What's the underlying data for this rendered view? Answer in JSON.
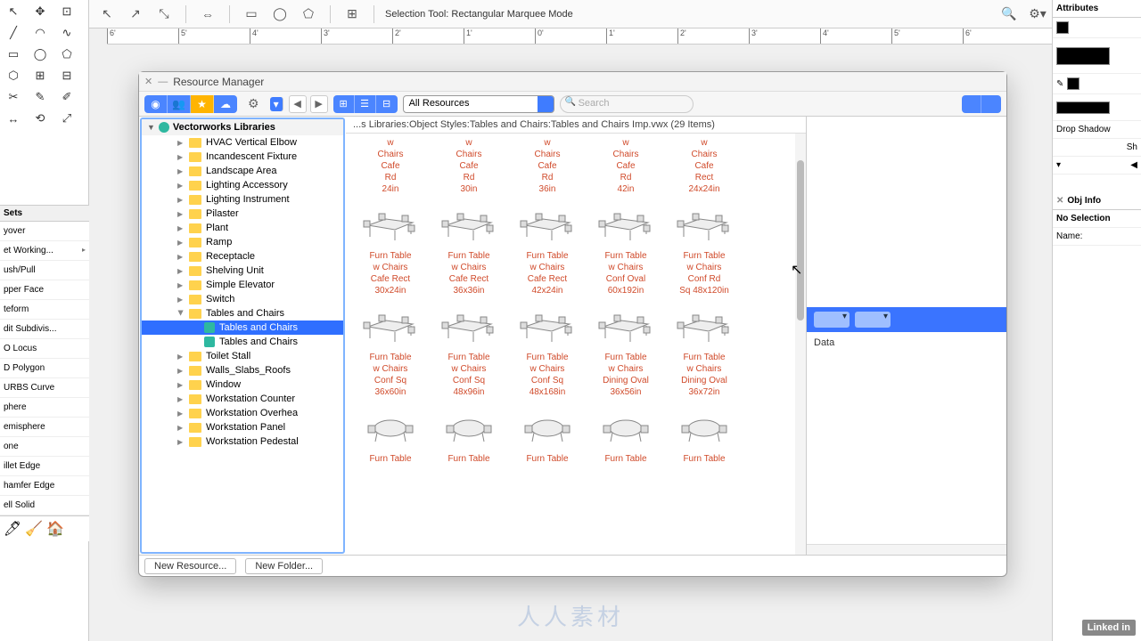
{
  "top_toolbar": {
    "label": "Selection Tool: Rectangular Marquee Mode"
  },
  "ruler_ticks": [
    "6'",
    "5'",
    "4'",
    "3'",
    "2'",
    "1'",
    "0'",
    "1'",
    "2'",
    "3'",
    "4'",
    "5'",
    "6'"
  ],
  "left_sets": {
    "head": "Sets",
    "rows": [
      "yover",
      "et Working...",
      "ush/Pull",
      "pper Face",
      "teform",
      "dit Subdivis...",
      "O Locus",
      "D Polygon",
      "URBS Curve",
      "phere",
      "emisphere",
      "one",
      "illet Edge",
      "hamfer Edge",
      "ell Solid"
    ]
  },
  "right_panel": {
    "attributes": "Attributes",
    "drop_shadow": "Drop Shadow",
    "obj_info": "Obj Info",
    "no_selection": "No Selection",
    "name_label": "Name:",
    "sh": "Sh"
  },
  "rm": {
    "title": "Resource Manager",
    "filter": "All Resources",
    "search_placeholder": "Search",
    "tree_head": "Vectorworks Libraries",
    "path": "...s Libraries:Object Styles:Tables and Chairs:Tables and Chairs Imp.vwx  (29 Items)",
    "preview_data": "Data",
    "new_resource": "New Resource...",
    "new_folder": "New Folder...",
    "folders": [
      "HVAC Vertical Elbow",
      "Incandescent Fixture",
      "Landscape Area",
      "Lighting Accessory",
      "Lighting Instrument",
      "Pilaster",
      "Plant",
      "Ramp",
      "Receptacle",
      "Shelving Unit",
      "Simple Elevator",
      "Switch"
    ],
    "folder_open": "Tables and Chairs",
    "files": [
      "Tables and Chairs",
      "Tables and Chairs"
    ],
    "folders_after": [
      "Toilet Stall",
      "Walls_Slabs_Roofs",
      "Window",
      "Workstation Counter",
      "Workstation Overhea",
      "Workstation Panel",
      "Workstation Pedestal"
    ],
    "partial_row": [
      "w Chairs Cafe Rd 24in",
      "w Chairs Cafe Rd 30in",
      "w Chairs Cafe Rd 36in",
      "w Chairs Cafe Rd 42in",
      "w Chairs Cafe Rect 24x24in"
    ],
    "rows": [
      [
        "Furn Table w Chairs Cafe Rect 30x24in",
        "Furn Table w Chairs Cafe Rect 36x36in",
        "Furn Table w Chairs Cafe Rect 42x24in",
        "Furn Table w Chairs Conf Oval 60x192in",
        "Furn Table w Chairs Conf Rd Sq 48x120in"
      ],
      [
        "Furn Table w Chairs Conf Sq 36x60in",
        "Furn Table w Chairs Conf Sq 48x96in",
        "Furn Table w Chairs Conf Sq 48x168in",
        "Furn Table w Chairs Dining Oval 36x56in",
        "Furn Table w Chairs Dining Oval 36x72in"
      ]
    ],
    "cut_row": [
      "Furn Table",
      "Furn Table",
      "Furn Table",
      "Furn Table",
      "Furn Table"
    ]
  },
  "watermark": "人人素材",
  "linkedin": "Linked in"
}
